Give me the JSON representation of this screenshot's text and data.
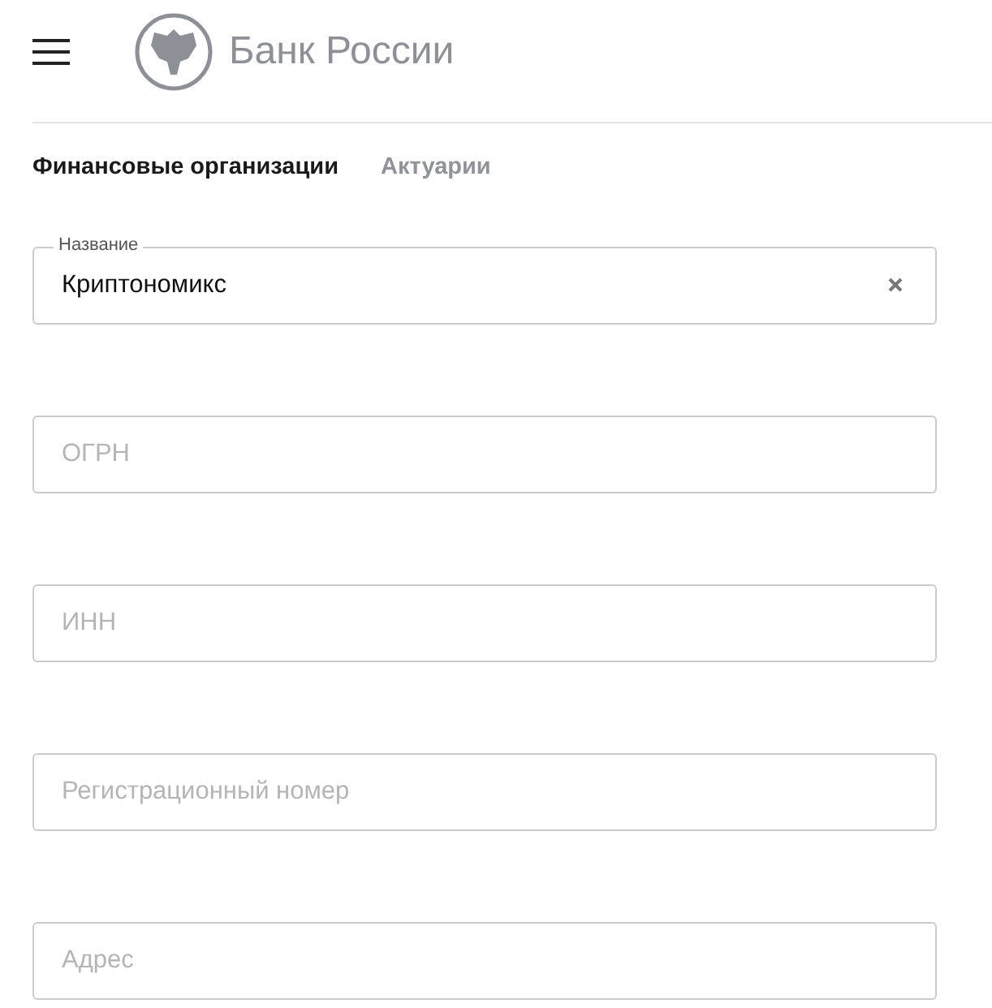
{
  "header": {
    "brand": "Банк России"
  },
  "tabs": [
    {
      "label": "Финансовые организации",
      "selected": true
    },
    {
      "label": "Актуарии",
      "selected": false
    }
  ],
  "fields": [
    {
      "label": "Название",
      "value": "Криптономикс",
      "clearable": true
    },
    {
      "placeholder": "ОГРН"
    },
    {
      "placeholder": "ИНН"
    },
    {
      "placeholder": "Регистрационный номер"
    },
    {
      "placeholder": "Адрес"
    }
  ]
}
